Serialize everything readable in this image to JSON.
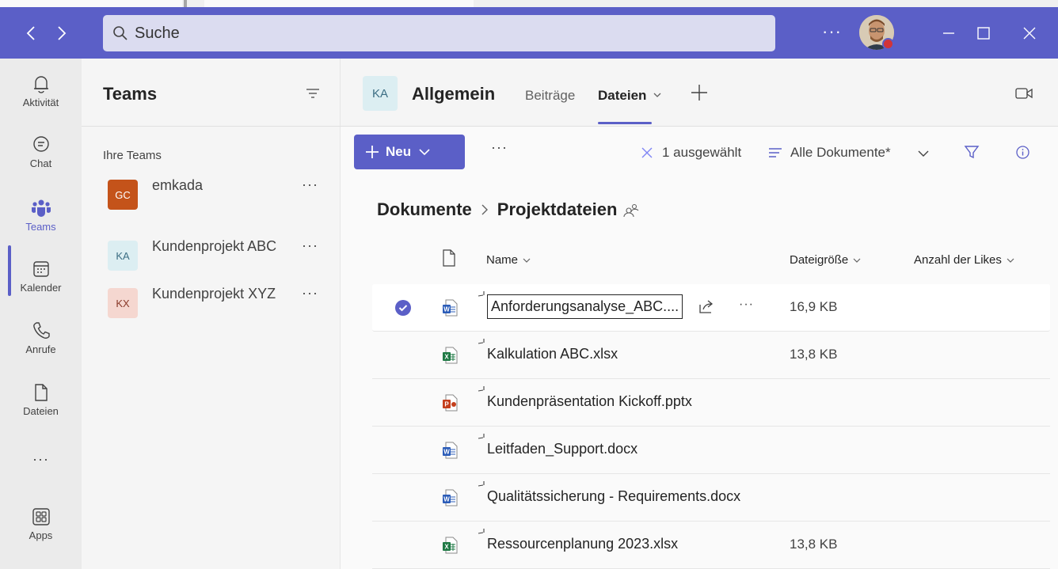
{
  "search": {
    "placeholder": "Suche"
  },
  "titlebar": {
    "more": "···"
  },
  "rail": {
    "items": [
      {
        "label": "Aktivität",
        "icon": "bell-icon"
      },
      {
        "label": "Chat",
        "icon": "chat-icon"
      },
      {
        "label": "Teams",
        "icon": "teams-icon",
        "active": true
      },
      {
        "label": "Kalender",
        "icon": "calendar-icon"
      },
      {
        "label": "Anrufe",
        "icon": "phone-icon"
      },
      {
        "label": "Dateien",
        "icon": "file-icon"
      },
      {
        "label": "···",
        "icon": "more-icon"
      },
      {
        "label": "Apps",
        "icon": "apps-icon"
      }
    ]
  },
  "teams_panel": {
    "title": "Teams",
    "section": "Ihre Teams",
    "teams": [
      {
        "initials": "GC",
        "name": "emkada",
        "more": "···",
        "badge_bg": "#c4531a",
        "badge_fg": "#ffffff"
      },
      {
        "initials": "KA",
        "name": "Kundenprojekt ABC",
        "more": "···",
        "badge_bg": "#dceef2",
        "badge_fg": "#3c6e84"
      },
      {
        "initials": "KX",
        "name": "Kundenprojekt XYZ",
        "more": "···",
        "badge_bg": "#f5d7d0",
        "badge_fg": "#8a3a2a"
      }
    ]
  },
  "channel": {
    "initials": "KA",
    "title": "Allgemein",
    "tabs": {
      "posts": "Beiträge",
      "files": "Dateien"
    }
  },
  "toolbar": {
    "new_label": "Neu",
    "more": "···",
    "selected_text": "1 ausgewählt",
    "view_label": "Alle Dokumente*"
  },
  "breadcrumb": {
    "root": "Dokumente",
    "current": "Projektdateien"
  },
  "columns": {
    "name": "Name",
    "size": "Dateigröße",
    "likes": "Anzahl der Likes"
  },
  "files": [
    {
      "name": "Anforderungsanalyse_ABC....",
      "type": "word",
      "size": "16,9 KB",
      "selected": true,
      "more": "···"
    },
    {
      "name": "Kalkulation ABC.xlsx",
      "type": "excel",
      "size": "13,8 KB"
    },
    {
      "name": "Kundenpräsentation Kickoff.pptx",
      "type": "powerpoint",
      "size": ""
    },
    {
      "name": "Leitfaden_Support.docx",
      "type": "word",
      "size": ""
    },
    {
      "name": "Qualitätssicherung - Requirements.docx",
      "type": "word",
      "size": ""
    },
    {
      "name": "Ressourcenplanung 2023.xlsx",
      "type": "excel",
      "size": "13,8 KB"
    }
  ],
  "colors": {
    "accent": "#5b5fc7",
    "word": "#2b5cb8",
    "excel": "#1f7a45",
    "powerpoint": "#c43e1c"
  }
}
